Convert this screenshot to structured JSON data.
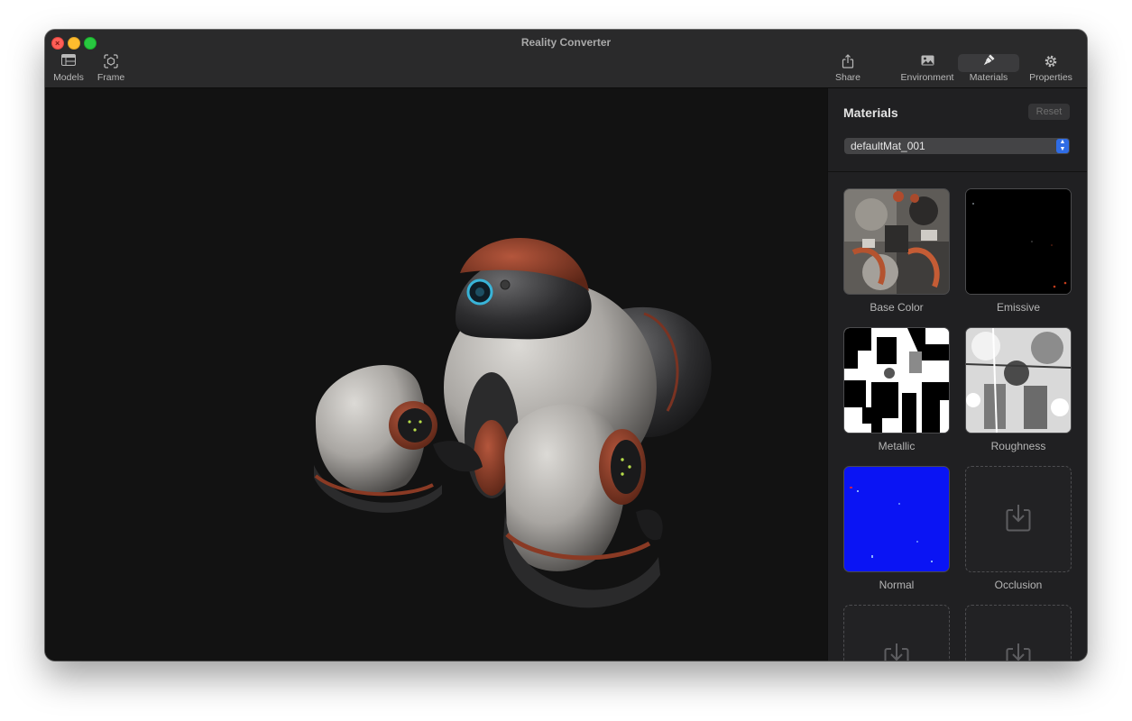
{
  "window": {
    "title": "Reality Converter"
  },
  "toolbar": {
    "models_label": "Models",
    "frame_label": "Frame",
    "share_label": "Share",
    "environment_label": "Environment",
    "materials_label": "Materials",
    "properties_label": "Properties",
    "active_item": "Materials"
  },
  "sidebar": {
    "title": "Materials",
    "reset_label": "Reset",
    "material_select": {
      "value": "defaultMat_001"
    },
    "slots": [
      {
        "label": "Base Color",
        "has_texture": true
      },
      {
        "label": "Emissive",
        "has_texture": true
      },
      {
        "label": "Metallic",
        "has_texture": true
      },
      {
        "label": "Roughness",
        "has_texture": true
      },
      {
        "label": "Normal",
        "has_texture": true
      },
      {
        "label": "Occlusion",
        "has_texture": false
      },
      {
        "label": "",
        "has_texture": false
      },
      {
        "label": "",
        "has_texture": false
      }
    ]
  },
  "colors": {
    "accent": "#2f6ce5",
    "window_bg": "#121212",
    "sidebar_bg": "#202022",
    "titlebar_bg": "#2a2a2b",
    "normal_map": "#0a14f4"
  },
  "icons": [
    "models-icon",
    "frame-icon",
    "share-icon",
    "environment-icon",
    "materials-icon",
    "properties-icon",
    "download-icon"
  ]
}
